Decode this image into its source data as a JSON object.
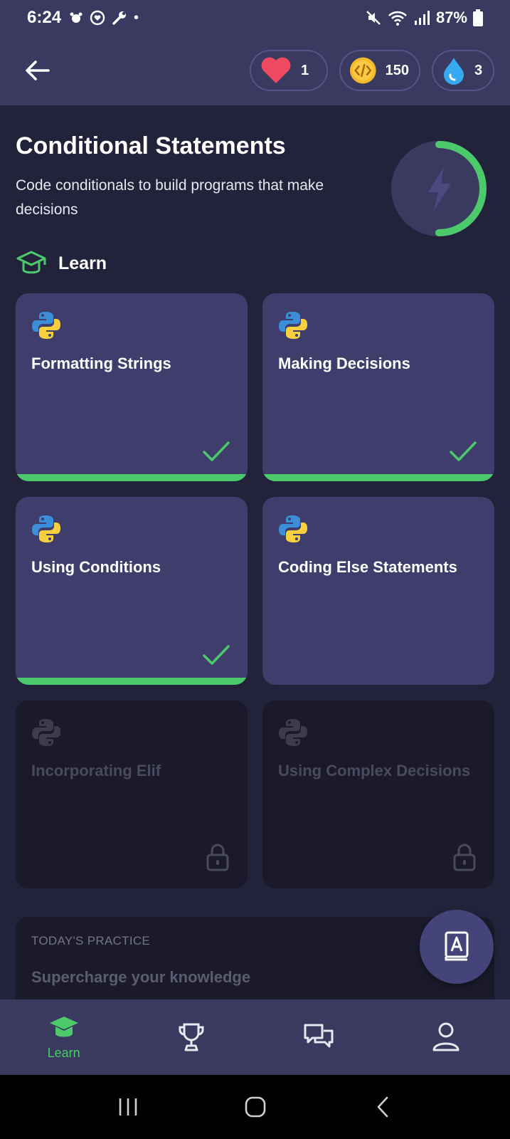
{
  "status_bar": {
    "time": "6:24",
    "battery": "87%",
    "dot": "•"
  },
  "header": {
    "hearts": "1",
    "coins": "150",
    "streak": "3"
  },
  "course": {
    "title": "Conditional Statements",
    "description": "Code conditionals to build programs that make decisions",
    "progress_fraction": 0.5
  },
  "learn_section": {
    "heading": "Learn"
  },
  "lessons": [
    {
      "title": "Formatting Strings",
      "status": "completed"
    },
    {
      "title": "Making Decisions",
      "status": "completed"
    },
    {
      "title": "Using Conditions",
      "status": "completed"
    },
    {
      "title": "Coding Else Statements",
      "status": "available"
    },
    {
      "title": "Incorporating Elif",
      "status": "locked"
    },
    {
      "title": "Using Complex Decisions",
      "status": "locked"
    }
  ],
  "practice": {
    "label": "TODAY'S PRACTICE",
    "title": "Supercharge your knowledge"
  },
  "bottom_nav": {
    "learn_label": "Learn"
  },
  "colors": {
    "accent_green": "#4cc96a",
    "header_bg": "#3a395f",
    "page_bg": "#22223a",
    "card_bg": "#3e3d6b",
    "locked_card_bg": "#1a1a2b"
  }
}
